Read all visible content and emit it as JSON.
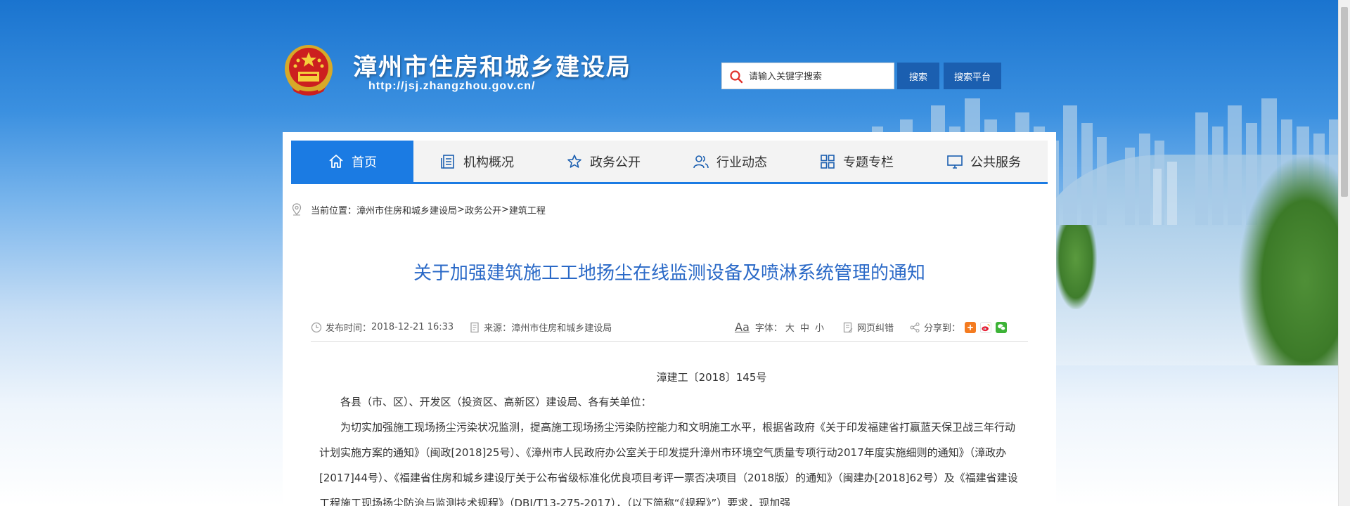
{
  "header": {
    "site_title": "漳州市住房和城乡建设局",
    "site_url": "http://jsj.zhangzhou.gov.cn/",
    "search_placeholder": "请输入关键字搜索",
    "search_button": "搜索",
    "platform_button": "搜索平台"
  },
  "nav": {
    "items": [
      {
        "label": "首页",
        "icon": "home-icon"
      },
      {
        "label": "机构概况",
        "icon": "document-icon"
      },
      {
        "label": "政务公开",
        "icon": "star-icon"
      },
      {
        "label": "行业动态",
        "icon": "people-icon"
      },
      {
        "label": "专题专栏",
        "icon": "grid-icon"
      },
      {
        "label": "公共服务",
        "icon": "monitor-icon"
      }
    ]
  },
  "breadcrumb": {
    "prefix": "当前位置：",
    "items": [
      "漳州市住房和城乡建设局",
      "政务公开",
      "建筑工程"
    ],
    "separator": ">"
  },
  "article": {
    "title": "关于加强建筑施工工地扬尘在线监测设备及喷淋系统管理的通知",
    "publish_label": "发布时间：",
    "publish_time": "2018-12-21 16:33",
    "source_label": "来源：",
    "source": "漳州市住房和城乡建设局",
    "aa": "Aa",
    "font_label": "字体：",
    "font_sizes": [
      "大",
      "中",
      "小"
    ],
    "correction": "网页纠错",
    "share_label": "分享到：",
    "doc_number": "漳建工〔2018〕145号",
    "salutation": "各县（市、区）、开发区（投资区、高新区）建设局、各有关单位：",
    "paragraph1": "为切实加强施工现场扬尘污染状况监测，提高施工现场扬尘污染防控能力和文明施工水平，根据省政府《关于印发福建省打赢蓝天保卫战三年行动计划实施方案的通知》（闽政[2018]25号）、《漳州市人民政府办公室关于印发提升漳州市环境空气质量专项行动2017年度实施细则的通知》（漳政办[2017]44号）、《福建省住房和城乡建设厅关于公布省级标准化优良项目考评一票否决项目（2018版）的通知》（闽建办[2018]62号）及《福建省建设工程施工现场扬尘防治与监测技术规程》（DBJ/T13-275-2017），（以下简称“《规程》”）要求，现加强"
  },
  "colors": {
    "nav_active": "#1b7be3",
    "title": "#2a69c7",
    "button": "#1b5fb0"
  }
}
